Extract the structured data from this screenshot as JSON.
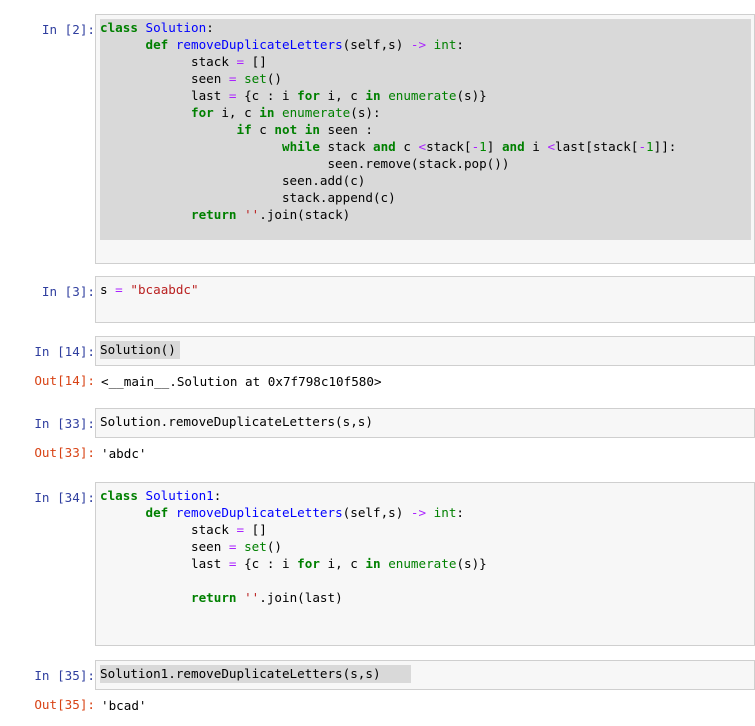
{
  "cells": [
    {
      "in_prompt": "In [2]:",
      "lines": [
        [
          [
            "kw",
            "class"
          ],
          [
            "t",
            " "
          ],
          [
            "nm",
            "Solution"
          ],
          [
            "t",
            ":"
          ]
        ],
        [
          [
            "t",
            "      "
          ],
          [
            "kw",
            "def"
          ],
          [
            "t",
            " "
          ],
          [
            "nm",
            "removeDuplicateLetters"
          ],
          [
            "t",
            "(self,s) "
          ],
          [
            "op",
            "->"
          ],
          [
            "t",
            " "
          ],
          [
            "bi",
            "int"
          ],
          [
            "t",
            ":"
          ]
        ],
        [
          [
            "t",
            "            stack "
          ],
          [
            "op",
            "="
          ],
          [
            "t",
            " []"
          ]
        ],
        [
          [
            "t",
            "            seen "
          ],
          [
            "op",
            "="
          ],
          [
            "t",
            " "
          ],
          [
            "bi",
            "set"
          ],
          [
            "t",
            "()"
          ]
        ],
        [
          [
            "t",
            "            last "
          ],
          [
            "op",
            "="
          ],
          [
            "t",
            " {c : i "
          ],
          [
            "kw",
            "for"
          ],
          [
            "t",
            " i, c "
          ],
          [
            "kw",
            "in"
          ],
          [
            "t",
            " "
          ],
          [
            "bi",
            "enumerate"
          ],
          [
            "t",
            "(s)}"
          ]
        ],
        [
          [
            "t",
            "            "
          ],
          [
            "kw",
            "for"
          ],
          [
            "t",
            " i, c "
          ],
          [
            "kw",
            "in"
          ],
          [
            "t",
            " "
          ],
          [
            "bi",
            "enumerate"
          ],
          [
            "t",
            "(s):"
          ]
        ],
        [
          [
            "t",
            "                  "
          ],
          [
            "kw",
            "if"
          ],
          [
            "t",
            " c "
          ],
          [
            "kw",
            "not"
          ],
          [
            "t",
            " "
          ],
          [
            "kw",
            "in"
          ],
          [
            "t",
            " seen :"
          ]
        ],
        [
          [
            "t",
            "                        "
          ],
          [
            "kw",
            "while"
          ],
          [
            "t",
            " stack "
          ],
          [
            "kw",
            "and"
          ],
          [
            "t",
            " c "
          ],
          [
            "op",
            "<"
          ],
          [
            "t",
            "stack["
          ],
          [
            "op",
            "-"
          ],
          [
            "num",
            "1"
          ],
          [
            "t",
            "] "
          ],
          [
            "kw",
            "and"
          ],
          [
            "t",
            " i "
          ],
          [
            "op",
            "<"
          ],
          [
            "t",
            "last[stack["
          ],
          [
            "op",
            "-"
          ],
          [
            "num",
            "1"
          ],
          [
            "t",
            "]]:"
          ]
        ],
        [
          [
            "t",
            "                              seen.remove(stack.pop())"
          ]
        ],
        [
          [
            "t",
            "                        seen.add(c)"
          ]
        ],
        [
          [
            "t",
            "                        stack.append(c)"
          ]
        ],
        [
          [
            "t",
            "            "
          ],
          [
            "kw",
            "return"
          ],
          [
            "t",
            " "
          ],
          [
            "str",
            "''"
          ],
          [
            "t",
            ".join(stack)"
          ]
        ]
      ]
    },
    {
      "in_prompt": "In [3]:",
      "lines": [
        [
          [
            "t",
            "s "
          ],
          [
            "op",
            "="
          ],
          [
            "t",
            " "
          ],
          [
            "str",
            "\"bcaabdc\""
          ]
        ]
      ]
    },
    {
      "in_prompt": "In [14]:",
      "lines": [
        [
          [
            "t",
            "Solution()"
          ]
        ]
      ],
      "out_prompt": "Out[14]:",
      "output": "<__main__.Solution at 0x7f798c10f580>"
    },
    {
      "in_prompt": "In [33]:",
      "lines": [
        [
          [
            "t",
            "Solution.removeDuplicateLetters(s,s)"
          ]
        ]
      ],
      "out_prompt": "Out[33]:",
      "output": "'abdc'"
    },
    {
      "in_prompt": "In [34]:",
      "lines": [
        [
          [
            "kw",
            "class"
          ],
          [
            "t",
            " "
          ],
          [
            "nm",
            "Solution1"
          ],
          [
            "t",
            ":"
          ]
        ],
        [
          [
            "t",
            "      "
          ],
          [
            "kw",
            "def"
          ],
          [
            "t",
            " "
          ],
          [
            "nm",
            "removeDuplicateLetters"
          ],
          [
            "t",
            "(self,s) "
          ],
          [
            "op",
            "->"
          ],
          [
            "t",
            " "
          ],
          [
            "bi",
            "int"
          ],
          [
            "t",
            ":"
          ]
        ],
        [
          [
            "t",
            "            stack "
          ],
          [
            "op",
            "="
          ],
          [
            "t",
            " []"
          ]
        ],
        [
          [
            "t",
            "            seen "
          ],
          [
            "op",
            "="
          ],
          [
            "t",
            " "
          ],
          [
            "bi",
            "set"
          ],
          [
            "t",
            "()"
          ]
        ],
        [
          [
            "t",
            "            last "
          ],
          [
            "op",
            "="
          ],
          [
            "t",
            " {c : i "
          ],
          [
            "kw",
            "for"
          ],
          [
            "t",
            " i, c "
          ],
          [
            "kw",
            "in"
          ],
          [
            "t",
            " "
          ],
          [
            "bi",
            "enumerate"
          ],
          [
            "t",
            "(s)}"
          ]
        ],
        [
          [
            "t",
            ""
          ]
        ],
        [
          [
            "t",
            "            "
          ],
          [
            "kw",
            "return"
          ],
          [
            "t",
            " "
          ],
          [
            "str",
            "''"
          ],
          [
            "t",
            ".join(last)"
          ]
        ]
      ]
    },
    {
      "in_prompt": "In [35]:",
      "lines": [
        [
          [
            "t",
            "Solution1.removeDuplicateLetters(s,s)"
          ]
        ]
      ],
      "out_prompt": "Out[35]:",
      "output": "'bcad'"
    }
  ]
}
